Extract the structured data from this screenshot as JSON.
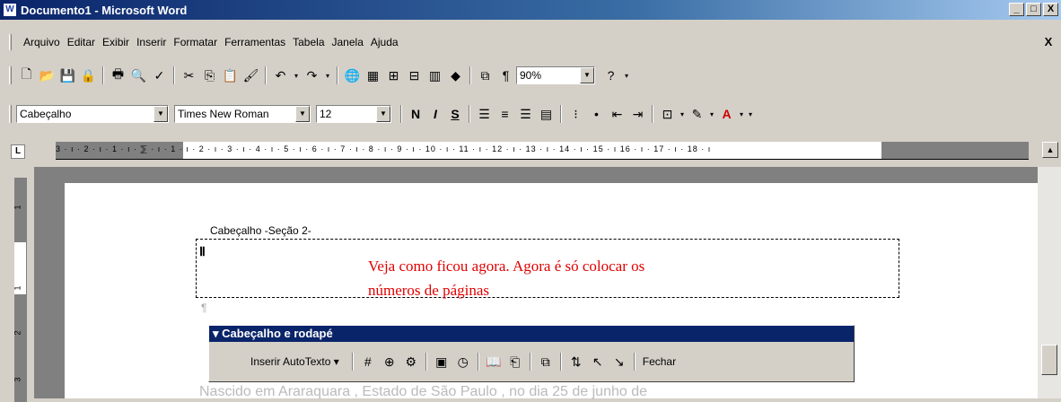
{
  "window": {
    "title": "Documento1 - Microsoft Word",
    "app_icon": "W",
    "buttons": [
      "_",
      "□",
      "X"
    ]
  },
  "menu": {
    "items": [
      "Arquivo",
      "Editar",
      "Exibir",
      "Inserir",
      "Formatar",
      "Ferramentas",
      "Tabela",
      "Janela",
      "Ajuda"
    ],
    "close": "X"
  },
  "standard_toolbar": {
    "zoom": "90%",
    "icons": [
      "new-document-icon",
      "open-icon",
      "save-icon",
      "permission-icon",
      "print-icon",
      "print-preview-icon",
      "spelling-icon",
      "cut-icon",
      "copy-icon",
      "paste-icon",
      "format-painter-icon",
      "undo-icon",
      "redo-icon",
      "hyperlink-icon",
      "tables-borders-icon",
      "insert-table-icon",
      "insert-excel-icon",
      "columns-icon",
      "drawing-icon",
      "document-map-icon",
      "show-hide-icon",
      "help-icon"
    ]
  },
  "formatting_toolbar": {
    "style": "Cabeçalho",
    "font": "Times New Roman",
    "size": "12",
    "bold": "N",
    "italic": "I",
    "underline": "S"
  },
  "ruler": {
    "ticks": "3 · ı · 2 · ı · 1 · ı · ⅀ · ı · 1 · ı · 2 · ı · 3 · ı · 4 · ı · 5 · ı · 6 · ı · 7 · ı · 8 · ı · 9 · ı · 10 · ı · 11 · ı · 12 · ı · 13 · ı · 14 · ı · 15 · ı 16 · ı · 17 · ı · 18 · ı",
    "tab_selector": "L",
    "vertical_numbers": [
      "1",
      "1",
      "2",
      "3"
    ]
  },
  "document": {
    "header_label": "Cabeçalho -Seção 2-",
    "red_text_line1": "Veja como ficou agora. Agora é só colocar os",
    "red_text_line2": "números de páginas",
    "bottom_text": "Nascido em Araraquara , Estado de São Paulo , no dia 25 de junho de"
  },
  "header_footer_toolbar": {
    "title": "Cabeçalho e rodapé",
    "autotext": "Inserir AutoTexto",
    "close": "Fechar"
  }
}
